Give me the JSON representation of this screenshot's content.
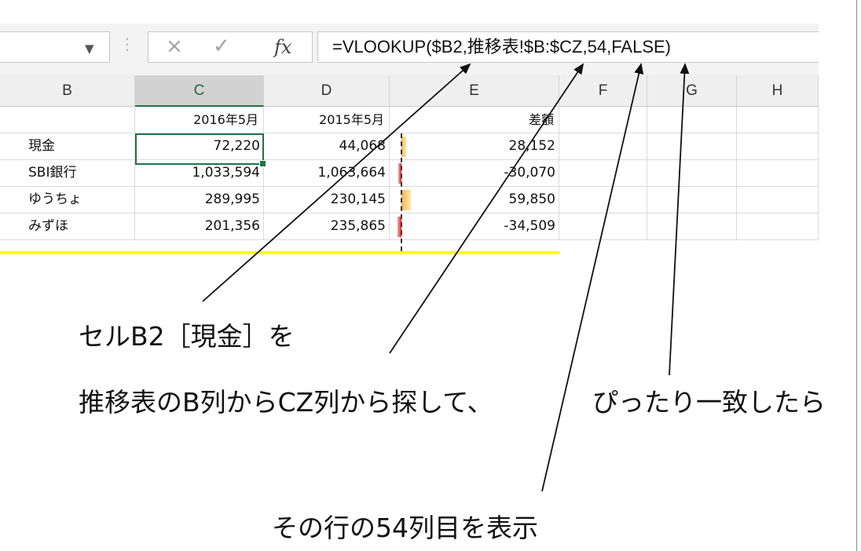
{
  "formula_bar": {
    "name_box_caret": "▼",
    "separator": "⋮",
    "cancel_icon": "×",
    "enter_icon": "✓",
    "fx_label": "fx",
    "formula": "=VLOOKUP($B2,推移表!$B:$CZ,54,FALSE)"
  },
  "columns": [
    "B",
    "C",
    "D",
    "E",
    "F",
    "G",
    "H"
  ],
  "selected_column": "C",
  "header_row": {
    "c": "2016年5月",
    "d": "2015年5月",
    "e": "差額"
  },
  "rows": [
    {
      "b": "現金",
      "c": "72,220",
      "d": "44,068",
      "e": "28,152",
      "diff": 28152
    },
    {
      "b": "SBI銀行",
      "c": "1,033,594",
      "d": "1,063,664",
      "e": "-30,070",
      "diff": -30070
    },
    {
      "b": "ゆうちょ",
      "c": "289,995",
      "d": "230,145",
      "e": "59,850",
      "diff": 59850
    },
    {
      "b": "みずほ",
      "c": "201,356",
      "d": "235,865",
      "e": "-34,509",
      "diff": -34509
    }
  ],
  "colors": {
    "accent": "#217346",
    "positive_bar": "#f5b94a",
    "negative_bar": "#e0262f",
    "highlight": "#ffff00"
  },
  "annotations": {
    "cell_ref": "セルB2［現金］を",
    "range": "推移表のB列からCZ列から探して、",
    "match": "ぴったり一致したら",
    "result": "その行の54列目を表示"
  }
}
